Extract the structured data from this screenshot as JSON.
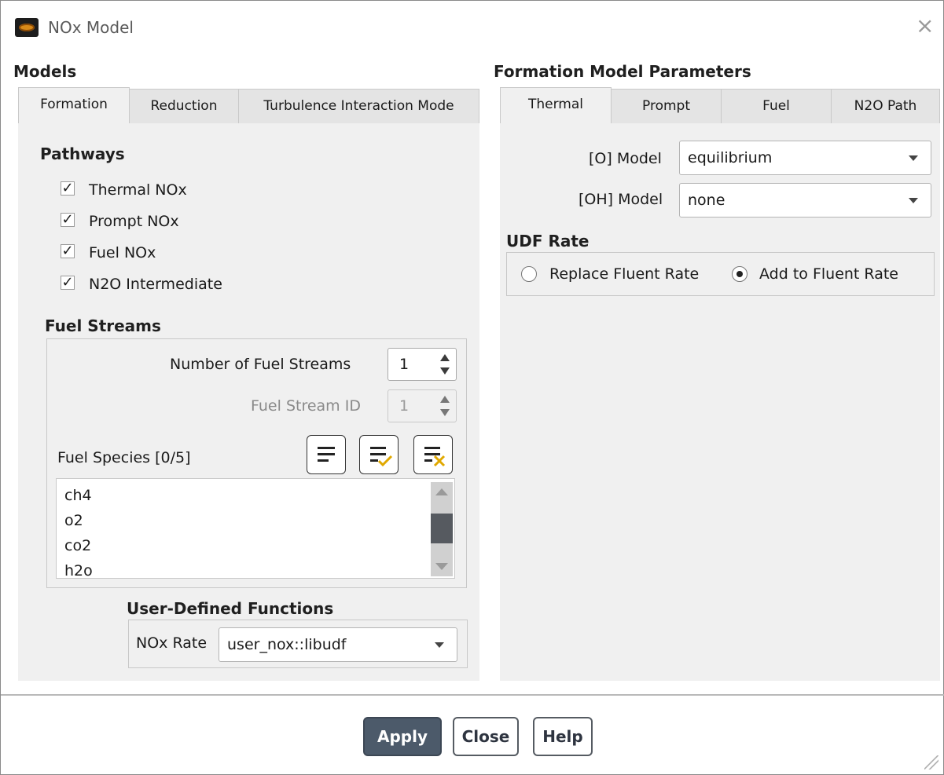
{
  "window": {
    "title": "NOx Model",
    "close_glyph": "×",
    "icon": "fluent-app-icon"
  },
  "models": {
    "heading": "Models",
    "tabs": [
      {
        "label": "Formation",
        "active": true
      },
      {
        "label": "Reduction",
        "active": false
      },
      {
        "label": "Turbulence Interaction Mode",
        "active": false
      }
    ],
    "pathways": {
      "heading": "Pathways",
      "items": [
        {
          "label": "Thermal NOx",
          "checked": true
        },
        {
          "label": "Prompt NOx",
          "checked": true
        },
        {
          "label": "Fuel NOx",
          "checked": true
        },
        {
          "label": "N2O Intermediate",
          "checked": true
        }
      ]
    },
    "fuel_streams": {
      "heading": "Fuel Streams",
      "number_label": "Number of Fuel Streams",
      "number_value": "1",
      "id_label": "Fuel Stream ID",
      "id_value": "1",
      "species_label": "Fuel Species [0/5]",
      "species": [
        "ch4",
        "o2",
        "co2",
        "h2o"
      ]
    },
    "udf": {
      "heading": "User-Defined Functions",
      "nox_rate_label": "NOx Rate",
      "nox_rate_value": "user_nox::libudf"
    }
  },
  "formation_params": {
    "heading": "Formation Model Parameters",
    "tabs": [
      {
        "label": "Thermal",
        "active": true
      },
      {
        "label": "Prompt",
        "active": false
      },
      {
        "label": "Fuel",
        "active": false
      },
      {
        "label": "N2O Path",
        "active": false
      }
    ],
    "o_model_label": "[O] Model",
    "o_model_value": "equilibrium",
    "oh_model_label": "[OH] Model",
    "oh_model_value": "none",
    "udf_rate": {
      "heading": "UDF Rate",
      "options": [
        {
          "label": "Replace Fluent Rate",
          "selected": false
        },
        {
          "label": "Add to Fluent Rate",
          "selected": true
        }
      ]
    }
  },
  "footer": {
    "apply_label": "Apply",
    "close_label": "Close",
    "help_label": "Help"
  },
  "colors": {
    "primary_button": "#4c5a6a",
    "panel_bg": "#f0f0f0",
    "scroll_thumb": "#565a60",
    "check_accent": "#e0a800"
  }
}
